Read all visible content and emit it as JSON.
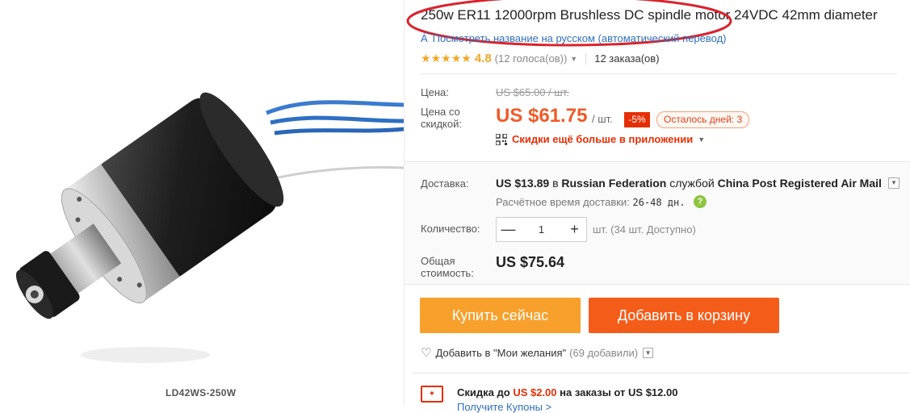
{
  "product": {
    "title": "250w ER11 12000rpm Brushless DC spindle motor 24VDC 42mm diameter",
    "translate_link": "Посмотреть название на русском (автоматический перевод)",
    "image_label": "LD42WS-250W"
  },
  "rating": {
    "stars": 5,
    "value": "4.8",
    "votes": "(12 голоса(ов))",
    "orders": "12 заказа(ов)"
  },
  "price": {
    "label": "Цена:",
    "old": "US $65.00 / шт.",
    "discount_label": "Цена со скидкой:",
    "new": "US $61.75",
    "unit": "/ шт.",
    "discount_badge": "-5%",
    "days_left": "Осталось дней: 3",
    "app_discount": "Скидки ещё больше в приложении"
  },
  "shipping": {
    "label": "Доставка:",
    "cost": "US $13.89",
    "text_in": "в",
    "country": "Russian Federation",
    "text_service": "службой",
    "carrier": "China Post Registered Air Mail",
    "eta_label": "Расчётное время доставки:",
    "eta_value": "26-48 дн."
  },
  "quantity": {
    "label": "Количество:",
    "value": "1",
    "available": "шт. (34 шт. Доступно)"
  },
  "total": {
    "label": "Общая стоимость:",
    "value": "US $75.64"
  },
  "actions": {
    "buy_now": "Купить сейчас",
    "add_to_cart": "Добавить в корзину",
    "wishlist": "Добавить в \"Мои желания\"",
    "wishlist_count": "(69 добавили)"
  },
  "coupon": {
    "prefix": "Скидка до",
    "amount": "US $2.00",
    "suffix": "на заказы от US $12.00",
    "link": "Получите Купоны >"
  },
  "colors": {
    "accent_orange": "#f05a28",
    "buy_button": "#f7a02c",
    "cart_button": "#f45c1a",
    "annotation_ellipse": "#d9232d",
    "link_blue": "#2f6fba"
  }
}
